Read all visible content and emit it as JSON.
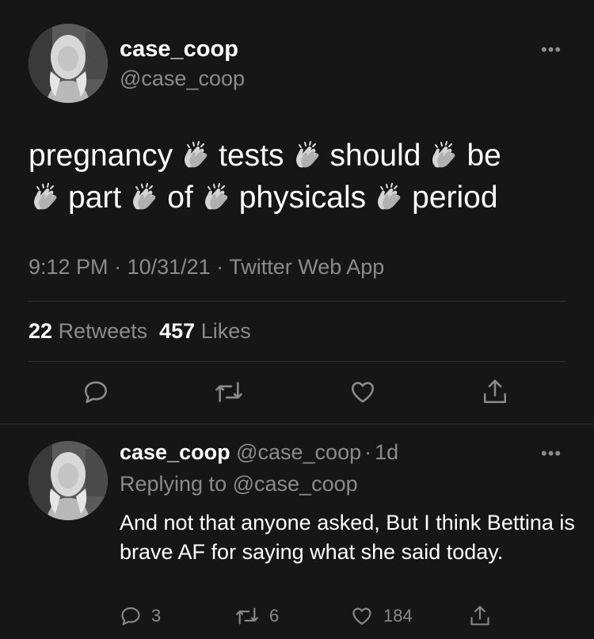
{
  "tweet": {
    "display_name": "case_coop",
    "handle": "@case_coop",
    "more_label": "•••",
    "text_parts": [
      "pregnancy",
      "tests",
      "should",
      "be",
      "part",
      "of",
      "physicals",
      "period"
    ],
    "time": "9:12 PM",
    "date": "10/31/21",
    "source": "Twitter Web App",
    "separator": "·",
    "retweet_count": "22",
    "retweet_label": "Retweets",
    "like_count": "457",
    "like_label": "Likes"
  },
  "reply": {
    "display_name": "case_coop",
    "handle": "@case_coop",
    "separator": "·",
    "age": "1d",
    "more_label": "•••",
    "replying_prefix": "Replying to",
    "replying_to": "@case_coop",
    "text": "And not that anyone asked, But I think Bettina is brave AF for saying what she said today.",
    "reply_count": "3",
    "retweet_count": "6",
    "like_count": "184"
  },
  "icons": {
    "clap": "clapping-hands-icon",
    "reply": "speech-bubble-icon",
    "retweet": "retweet-arrows-icon",
    "like": "heart-icon",
    "share": "share-upload-icon"
  },
  "colors": {
    "background": "#161616",
    "text": "#ffffff",
    "muted": "#8b8b8b",
    "divider": "#2f2f2f"
  }
}
